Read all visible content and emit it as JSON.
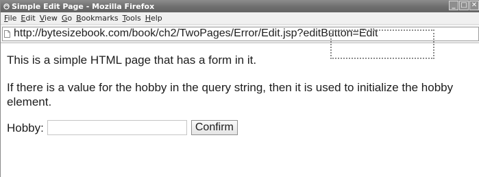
{
  "window": {
    "title": "Simple Edit Page - Mozilla Firefox"
  },
  "menubar": {
    "items": [
      {
        "label": "File",
        "mnemonic": "F",
        "rest": "ile"
      },
      {
        "label": "Edit",
        "mnemonic": "E",
        "rest": "dit"
      },
      {
        "label": "View",
        "mnemonic": "V",
        "rest": "iew"
      },
      {
        "label": "Go",
        "mnemonic": "G",
        "rest": "o"
      },
      {
        "label": "Bookmarks",
        "mnemonic": "B",
        "rest": "ookmarks"
      },
      {
        "label": "Tools",
        "mnemonic": "T",
        "rest": "ools"
      },
      {
        "label": "Help",
        "mnemonic": "H",
        "rest": "elp"
      }
    ]
  },
  "address": {
    "url": "http://bytesizebook.com/book/ch2/TwoPages/Error/Edit.jsp?editButton=Edit"
  },
  "page": {
    "intro": "This is a simple HTML page that has a form in it.",
    "explanation": "If there is a value for the hobby in the query string, then it is used to initialize the hobby element.",
    "form": {
      "hobby_label": "Hobby:",
      "hobby_value": "",
      "confirm_label": "Confirm"
    }
  },
  "icons": {
    "app": "firefox-icon",
    "page": "page-icon",
    "minimize": "minimize-icon",
    "maximize": "maximize-icon",
    "close": "close-icon"
  }
}
